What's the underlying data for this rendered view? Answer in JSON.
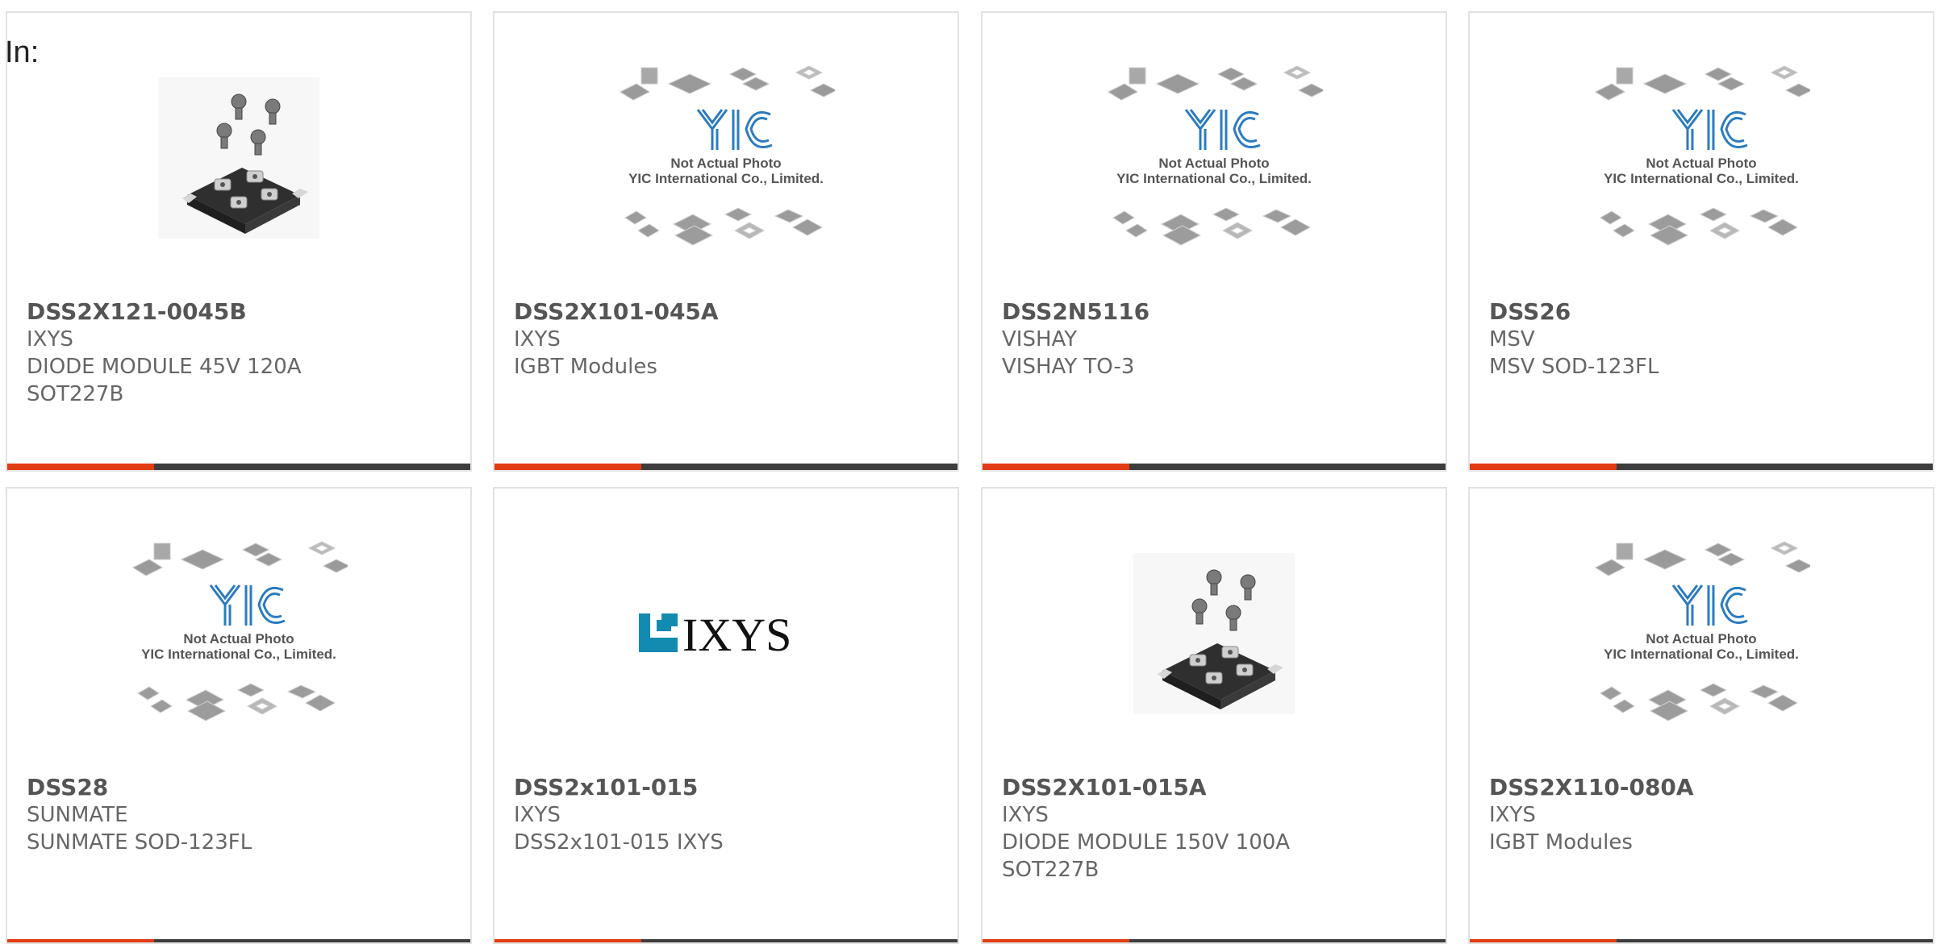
{
  "filter": {
    "label": "In:"
  },
  "colors": {
    "accent": "#e23c14",
    "bar": "#3d3d3d"
  },
  "placeholder": {
    "line1": "Not Actual Photo",
    "line2": "YIC International Co., Limited.",
    "logo": "YIC"
  },
  "cards": [
    {
      "part": "DSS2X121-0045B",
      "brand": "IXYS",
      "desc": [
        "DIODE MODULE 45V 120A",
        "SOT227B"
      ],
      "image": "module-photo"
    },
    {
      "part": "DSS2X101-045A",
      "brand": "IXYS",
      "desc": [
        "IGBT Modules"
      ],
      "image": "placeholder"
    },
    {
      "part": "DSS2N5116",
      "brand": "VISHAY",
      "desc": [
        "VISHAY TO-3"
      ],
      "image": "placeholder"
    },
    {
      "part": "DSS26",
      "brand": "MSV",
      "desc": [
        "MSV SOD-123FL"
      ],
      "image": "placeholder"
    },
    {
      "part": "DSS28",
      "brand": "SUNMATE",
      "desc": [
        "SUNMATE SOD-123FL"
      ],
      "image": "placeholder"
    },
    {
      "part": "DSS2x101-015",
      "brand": "IXYS",
      "desc": [
        "DSS2x101-015 IXYS"
      ],
      "image": "ixys-logo",
      "logo_text": "IXYS"
    },
    {
      "part": "DSS2X101-015A",
      "brand": "IXYS",
      "desc": [
        "DIODE MODULE 150V 100A",
        "SOT227B"
      ],
      "image": "module-photo"
    },
    {
      "part": "DSS2X110-080A",
      "brand": "IXYS",
      "desc": [
        "IGBT Modules"
      ],
      "image": "placeholder"
    }
  ]
}
